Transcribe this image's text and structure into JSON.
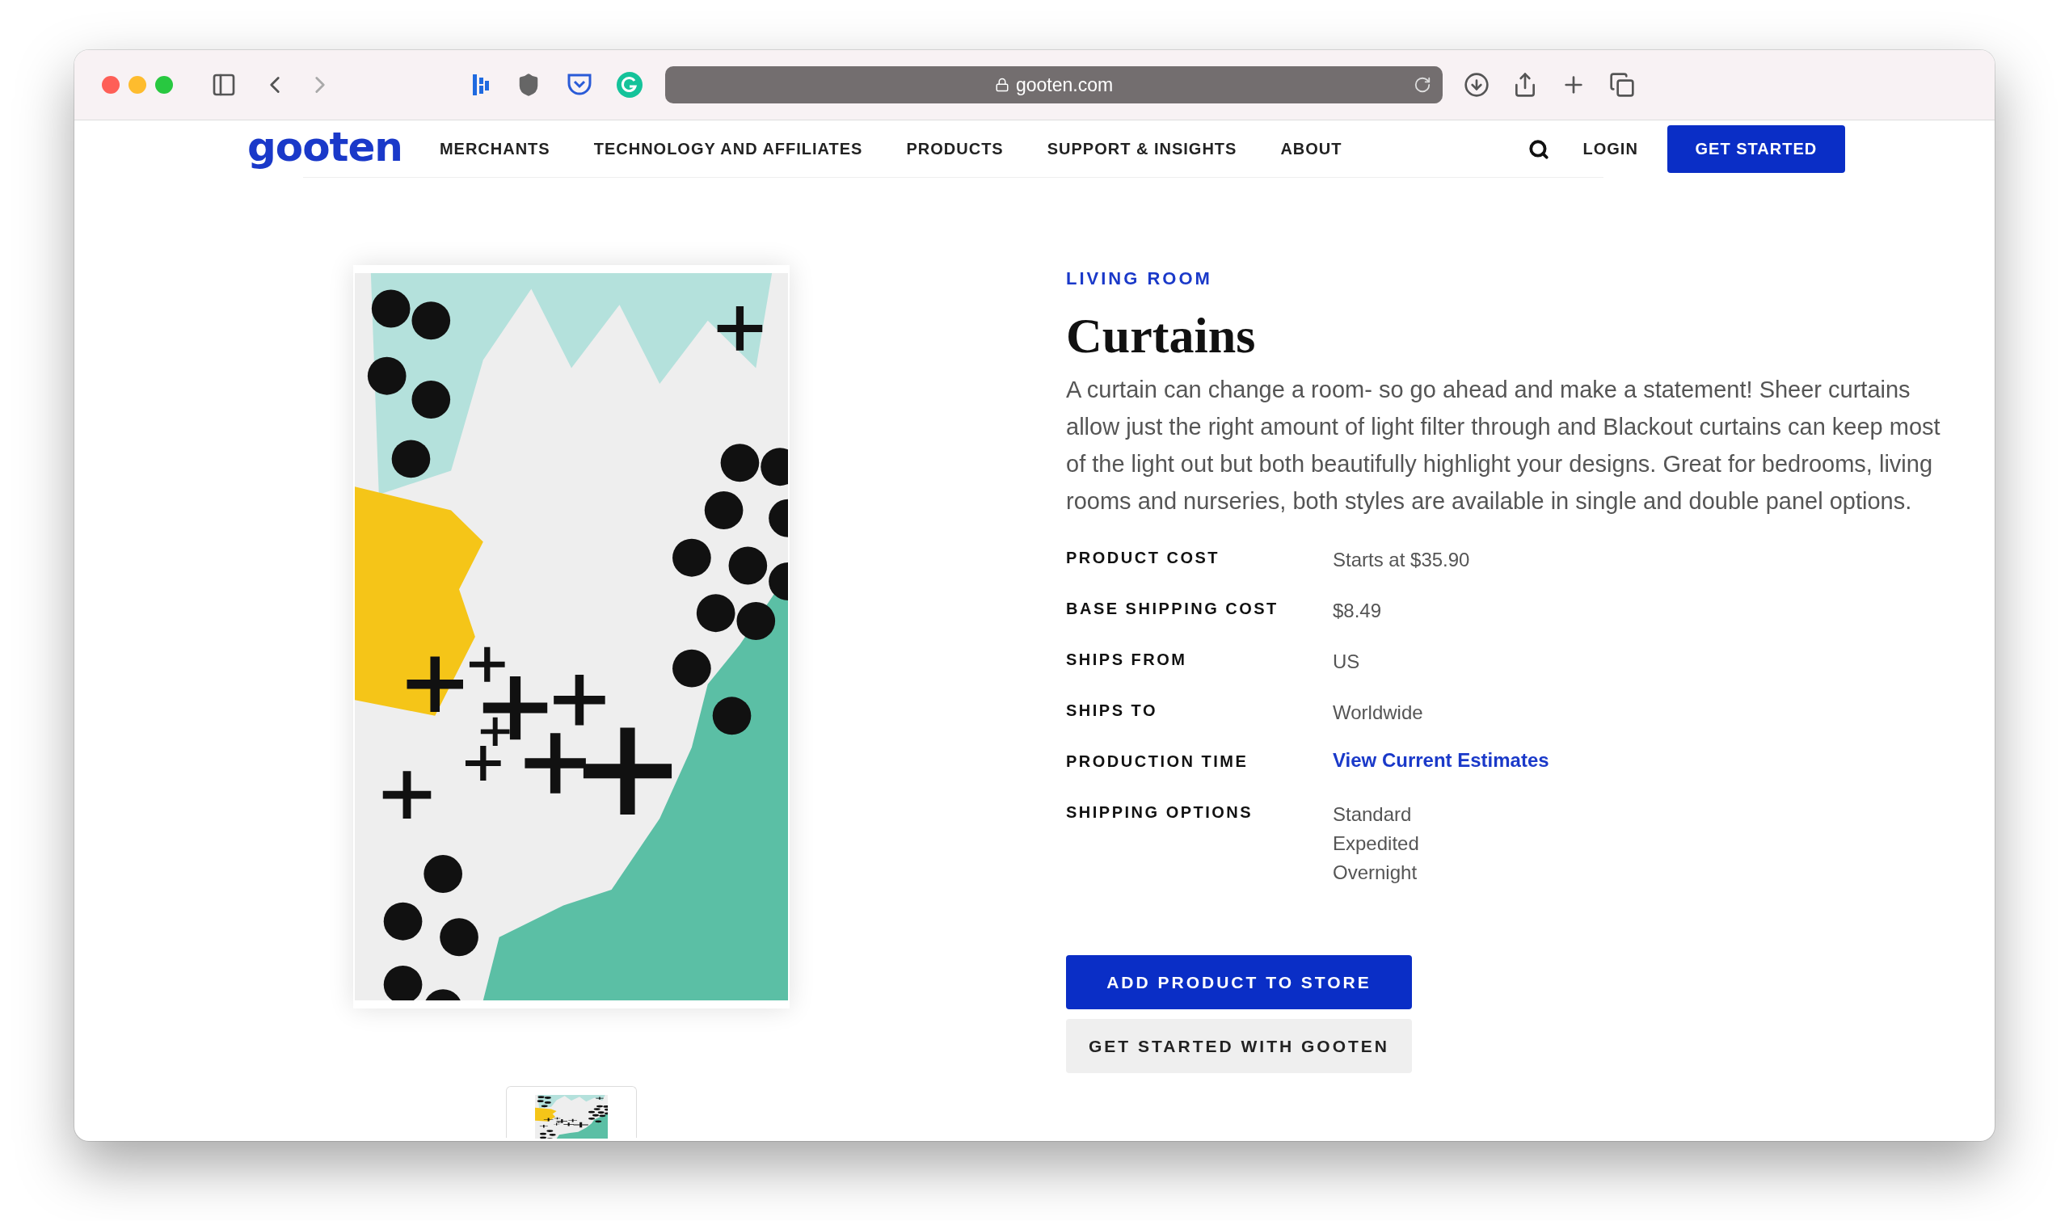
{
  "browser": {
    "url": "gooten.com"
  },
  "nav": {
    "logo": "gooten",
    "items": [
      "MERCHANTS",
      "TECHNOLOGY AND AFFILIATES",
      "PRODUCTS",
      "SUPPORT & INSIGHTS",
      "ABOUT"
    ],
    "login": "LOGIN",
    "cta": "GET STARTED"
  },
  "product": {
    "category": "LIVING ROOM",
    "title": "Curtains",
    "description": "A curtain can change a room- so go ahead and make a statement! Sheer curtains allow just the right amount of light filter through and Blackout curtains can keep most of the light out but both beautifully highlight your designs. Great for bedrooms, living rooms and nurseries, both styles are available in single and double panel options.",
    "specs": [
      {
        "label": "PRODUCT COST",
        "kind": "text",
        "value": "Starts at $35.90"
      },
      {
        "label": "BASE SHIPPING COST",
        "kind": "text",
        "value": "$8.49"
      },
      {
        "label": "SHIPS FROM",
        "kind": "text",
        "value": "US"
      },
      {
        "label": "SHIPS TO",
        "kind": "text",
        "value": "Worldwide"
      },
      {
        "label": "PRODUCTION TIME",
        "kind": "link",
        "value": "View Current Estimates"
      },
      {
        "label": "SHIPPING OPTIONS",
        "kind": "list",
        "values": [
          "Standard",
          "Expedited",
          "Overnight"
        ]
      }
    ],
    "primary_button": "ADD PRODUCT TO STORE",
    "secondary_button": "GET STARTED WITH GOOTEN"
  }
}
